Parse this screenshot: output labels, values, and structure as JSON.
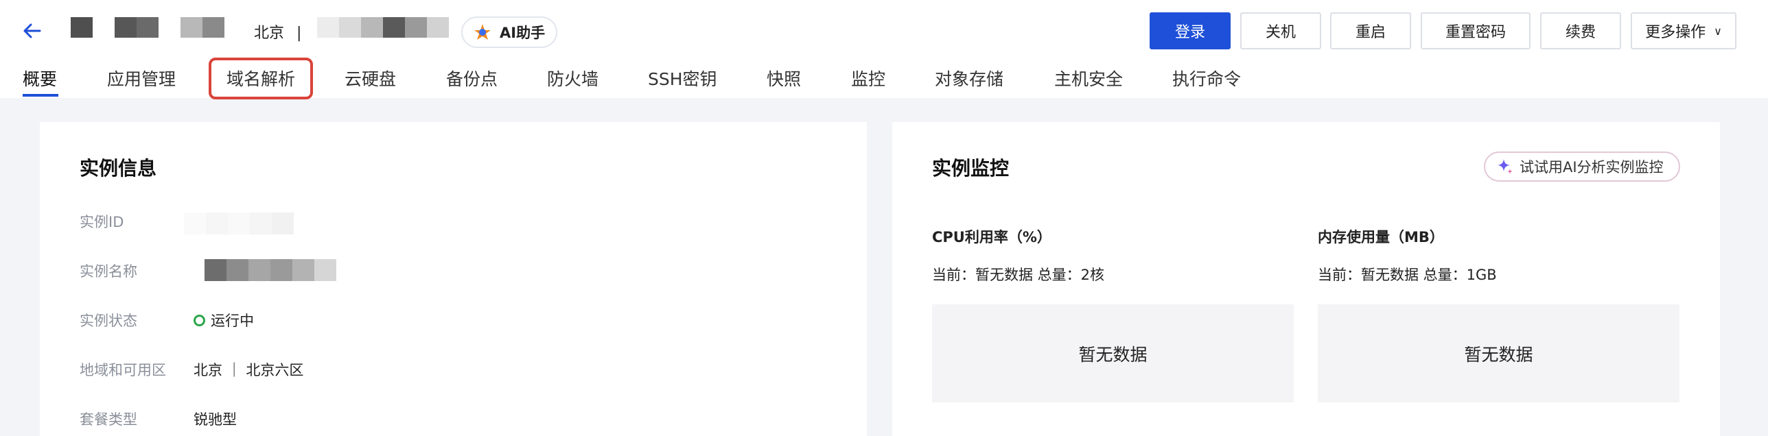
{
  "header": {
    "region": "北京",
    "region_separator": "|",
    "ai_assistant_label": "AI助手"
  },
  "actions": {
    "login": "登录",
    "shutdown": "关机",
    "restart": "重启",
    "reset_password": "重置密码",
    "renew": "续费",
    "more": "更多操作"
  },
  "tabs": [
    {
      "label": "概要",
      "active": true
    },
    {
      "label": "应用管理"
    },
    {
      "label": "域名解析",
      "highlighted": true
    },
    {
      "label": "云硬盘"
    },
    {
      "label": "备份点"
    },
    {
      "label": "防火墙"
    },
    {
      "label": "SSH密钥"
    },
    {
      "label": "快照"
    },
    {
      "label": "监控"
    },
    {
      "label": "对象存储"
    },
    {
      "label": "主机安全"
    },
    {
      "label": "执行命令"
    }
  ],
  "instance_info": {
    "title": "实例信息",
    "rows": [
      {
        "label": "实例ID",
        "value": ""
      },
      {
        "label": "实例名称",
        "value": ""
      },
      {
        "label": "实例状态",
        "value": "运行中"
      },
      {
        "label": "地域和可用区",
        "value": "北京 ｜ 北京六区"
      },
      {
        "label": "套餐类型",
        "value": "锐驰型"
      }
    ]
  },
  "monitoring": {
    "title": "实例监控",
    "try_ai_label": "试试用AI分析实例监控",
    "metrics": [
      {
        "title": "CPU利用率（%）",
        "summary": "当前：暂无数据 总量：2核",
        "empty_text": "暂无数据"
      },
      {
        "title": "内存使用量（MB）",
        "summary": "当前：暂无数据 总量：1GB",
        "empty_text": "暂无数据"
      }
    ]
  },
  "colors": {
    "primary": "#1e50d9",
    "highlight": "#d9443a",
    "status_running": "#2ba64a"
  },
  "icons": {
    "back": "arrow-left-icon",
    "ai_logo": "ai-assistant-logo-icon",
    "status": "status-ring-icon",
    "sparkle": "sparkle-icon",
    "more_chevron": "chevron-down-icon"
  }
}
